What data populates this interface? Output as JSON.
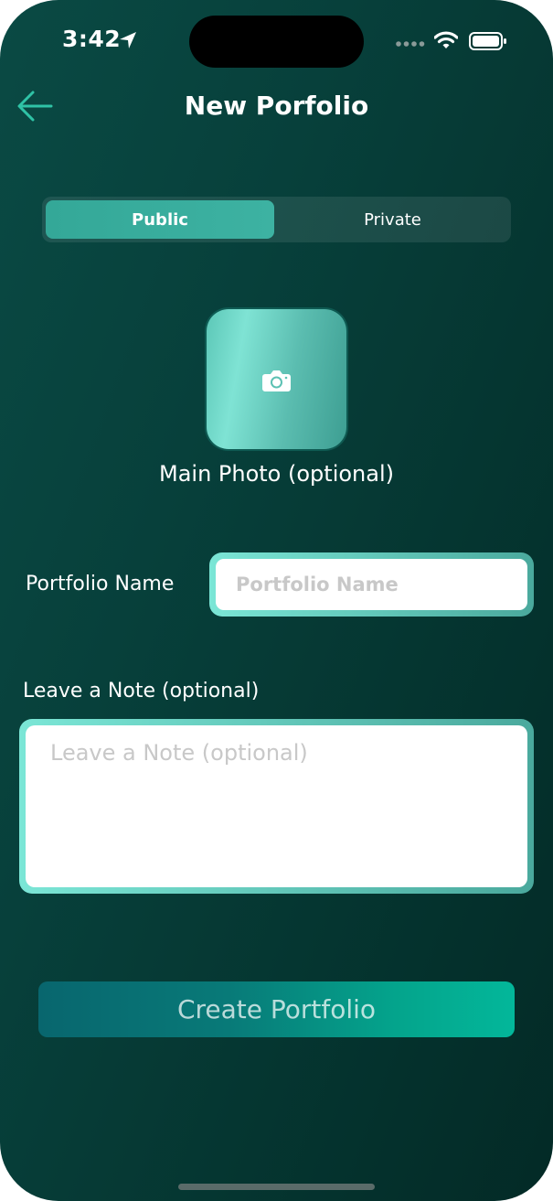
{
  "status_bar": {
    "time": "3:42",
    "location_icon": "location-arrow-icon",
    "signal_icon": "signal-dots-icon",
    "wifi_icon": "wifi-icon",
    "battery_icon": "battery-icon"
  },
  "header": {
    "title": "New Porfolio",
    "back_icon": "arrow-left-icon"
  },
  "visibility": {
    "options": [
      "Public",
      "Private"
    ],
    "selected": "Public"
  },
  "photo": {
    "icon": "camera-icon",
    "label": "Main Photo (optional)"
  },
  "portfolio_name": {
    "label": "Portfolio Name",
    "value": "",
    "placeholder": "Portfolio Name"
  },
  "note": {
    "label": "Leave a Note (optional)",
    "value": "",
    "placeholder": "Leave a Note (optional)"
  },
  "actions": {
    "create_label": "Create Portfolio"
  },
  "colors": {
    "background": "#06403a",
    "accent": "#3db2a2",
    "field_border": "#7be6d6",
    "button_start": "#08666e",
    "button_end": "#03b79a"
  }
}
